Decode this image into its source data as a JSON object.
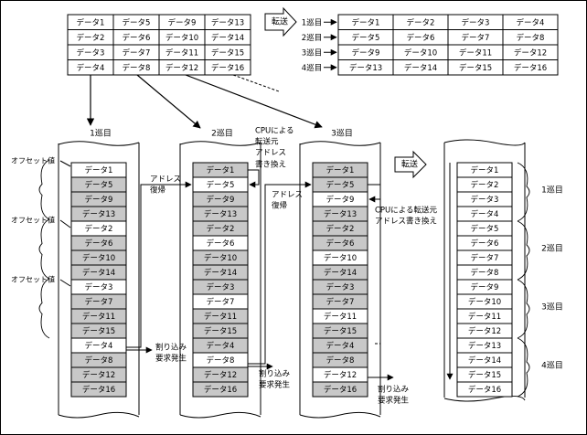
{
  "labels": {
    "transfer": "転送",
    "pass1": "1巡目",
    "pass2": "2巡目",
    "pass3": "3巡目",
    "pass4": "4巡目",
    "offset": "オフセット値",
    "addr_restore": [
      "アドレス",
      "復帰"
    ],
    "cpu_note_col2": [
      "CPUによる",
      "転送元",
      "アドレス",
      "書き換え"
    ],
    "cpu_note_col3": [
      "CPUによる転送元",
      "アドレス書き換え"
    ],
    "interrupt": [
      "割り込み",
      "要求発生"
    ]
  },
  "src_table": [
    [
      "データ1",
      "データ5",
      "データ9",
      "データ13"
    ],
    [
      "データ2",
      "データ6",
      "データ10",
      "データ14"
    ],
    [
      "データ3",
      "データ7",
      "データ11",
      "データ15"
    ],
    [
      "データ4",
      "データ8",
      "データ12",
      "データ16"
    ]
  ],
  "dst_table": {
    "row_labels": [
      "1巡目",
      "2巡目",
      "3巡目",
      "4巡目"
    ],
    "rows": [
      [
        "データ1",
        "データ2",
        "データ3",
        "データ4"
      ],
      [
        "データ5",
        "データ6",
        "データ7",
        "データ8"
      ],
      [
        "データ9",
        "データ10",
        "データ11",
        "データ12"
      ],
      [
        "データ13",
        "データ14",
        "データ15",
        "データ16"
      ]
    ]
  },
  "memory_columns": [
    {
      "title": "1巡目",
      "cells": [
        "データ1",
        "データ5",
        "データ9",
        "データ13",
        "データ2",
        "データ6",
        "データ10",
        "データ14",
        "データ3",
        "データ7",
        "データ11",
        "データ15",
        "データ4",
        "データ8",
        "データ12",
        "データ16"
      ],
      "white": [
        0,
        4,
        8,
        12
      ]
    },
    {
      "title": "2巡目",
      "cells": [
        "データ1",
        "データ5",
        "データ9",
        "データ13",
        "データ2",
        "データ6",
        "データ10",
        "データ14",
        "データ3",
        "データ7",
        "データ11",
        "データ15",
        "データ4",
        "データ8",
        "データ12",
        "データ16"
      ],
      "white": [
        1,
        5,
        9,
        13
      ]
    },
    {
      "title": "3巡目",
      "cells": [
        "データ1",
        "データ5",
        "データ9",
        "データ13",
        "データ2",
        "データ6",
        "データ10",
        "データ14",
        "データ3",
        "データ7",
        "データ11",
        "データ15",
        "データ4",
        "データ8",
        "データ12",
        "データ16"
      ],
      "white": [
        2,
        6,
        10,
        14
      ]
    }
  ],
  "result_column": {
    "cells": [
      "データ1",
      "データ2",
      "データ3",
      "データ4",
      "データ5",
      "データ6",
      "データ7",
      "データ8",
      "データ9",
      "データ10",
      "データ11",
      "データ12",
      "データ13",
      "データ14",
      "データ15",
      "データ16"
    ],
    "group_labels": [
      "1巡目",
      "2巡目",
      "3巡目",
      "4巡目"
    ]
  },
  "colors": {
    "shaded": "#c8c8c8",
    "white": "#ffffff",
    "line": "#000000"
  }
}
